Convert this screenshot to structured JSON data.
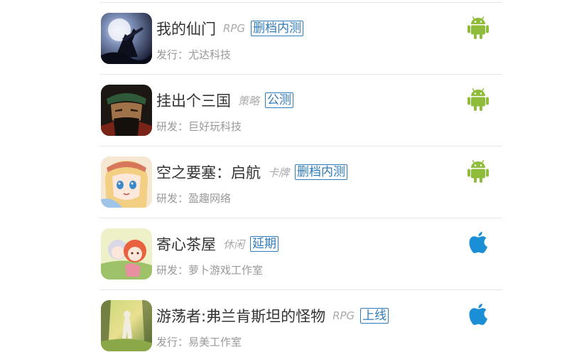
{
  "colors": {
    "android": "#8fbd3b",
    "apple": "#1a8fd6",
    "status": "#2f7ab8"
  },
  "games": [
    {
      "title": "我的仙门",
      "genre": "RPG",
      "status": "删档内测",
      "company": "发行：尤达科技",
      "platform": "android-icon",
      "thumb": "dark-moon-swordsman-art"
    },
    {
      "title": "挂出个三国",
      "genre": "策略",
      "status": "公测",
      "company": "研发：巨好玩科技",
      "platform": "android-icon",
      "thumb": "bearded-general-portrait-art"
    },
    {
      "title": "空之要塞：启航",
      "genre": "卡牌",
      "status": "删档内测",
      "company": "研发：盈趣网络",
      "platform": "android-icon",
      "thumb": "anime-girl-portrait-art"
    },
    {
      "title": "寄心茶屋",
      "genre": "休闲",
      "status": "延期",
      "company": "研发：萝卜游戏工作室",
      "platform": "apple-icon",
      "thumb": "two-chibi-girls-art"
    },
    {
      "title": "游荡者:弗兰肯斯坦的怪物",
      "genre": "RPG",
      "status": "上线",
      "company": "发行：易美工作室",
      "platform": "apple-icon",
      "thumb": "forest-wanderer-art"
    }
  ]
}
